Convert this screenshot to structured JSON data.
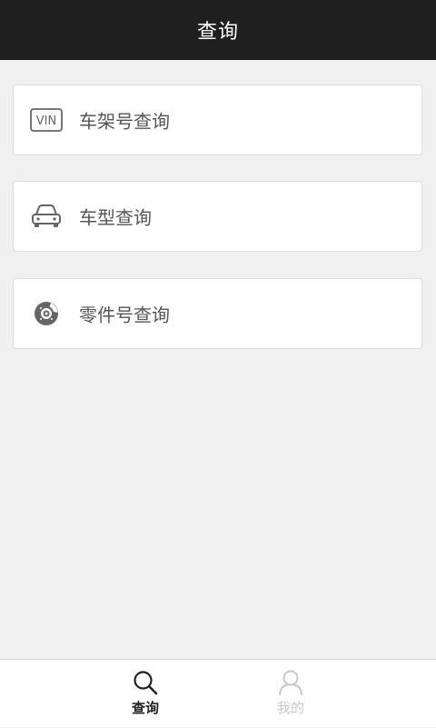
{
  "header": {
    "title": "查询"
  },
  "menu": {
    "items": [
      {
        "label": "车架号查询",
        "icon": "vin-icon",
        "icon_text": "VIN"
      },
      {
        "label": "车型查询",
        "icon": "car-icon"
      },
      {
        "label": "零件号查询",
        "icon": "brake-disc-icon"
      }
    ]
  },
  "tabbar": {
    "tabs": [
      {
        "label": "查询",
        "icon": "search-icon",
        "active": true
      },
      {
        "label": "我的",
        "icon": "user-icon",
        "active": false
      }
    ]
  },
  "colors": {
    "header_bg": "#1f1f1f",
    "page_bg": "#f0f0f0",
    "icon_gray": "#666666",
    "active_tab": "#222222",
    "inactive_tab": "#c8c8c8"
  }
}
